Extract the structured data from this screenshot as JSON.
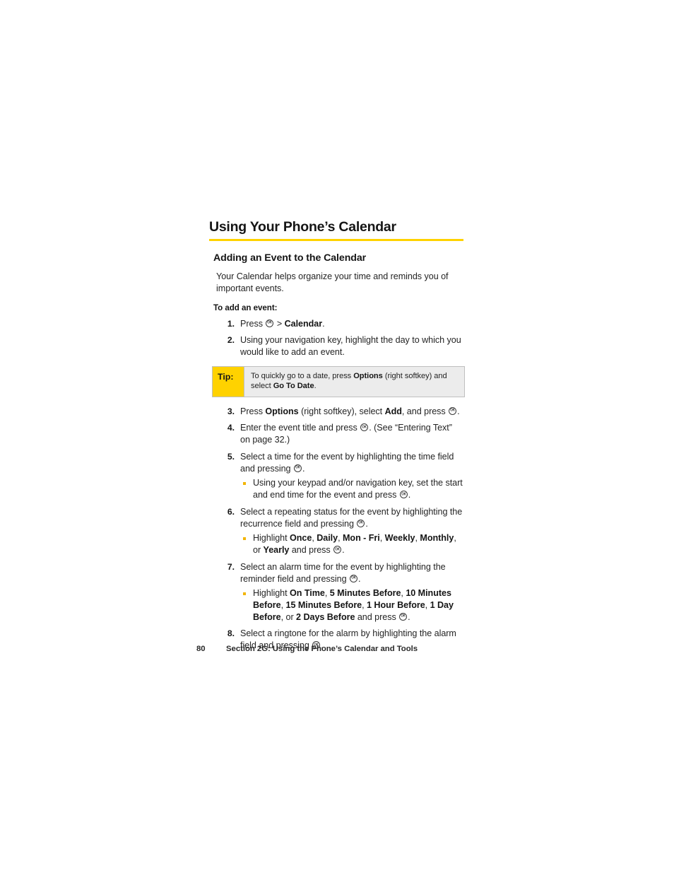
{
  "page": {
    "heading": "Using Your Phone’s Calendar",
    "accent_color": "#FFD200",
    "rule_color": "#FFD200",
    "bullet_color": "#F2B400"
  },
  "section": {
    "subheading": "Adding an Event to the Calendar",
    "intro": "Your Calendar helps organize your time and reminds you of important events.",
    "lead_in": "To add an event:"
  },
  "steps": [
    {
      "number": "1.",
      "parts": [
        {
          "t": "text",
          "v": "Press "
        },
        {
          "t": "okkey"
        },
        {
          "t": "text",
          "v": " > "
        },
        {
          "t": "bold",
          "v": "Calendar"
        },
        {
          "t": "text",
          "v": "."
        }
      ]
    },
    {
      "number": "2.",
      "parts": [
        {
          "t": "text",
          "v": "Using your navigation key, highlight the day to which you would like to add an event."
        }
      ]
    },
    {
      "number": "3.",
      "parts": [
        {
          "t": "text",
          "v": "Press "
        },
        {
          "t": "bold",
          "v": "Options"
        },
        {
          "t": "text",
          "v": " (right softkey), select "
        },
        {
          "t": "bold",
          "v": "Add"
        },
        {
          "t": "text",
          "v": ", and press "
        },
        {
          "t": "okkey"
        },
        {
          "t": "text",
          "v": "."
        }
      ]
    },
    {
      "number": "4.",
      "parts": [
        {
          "t": "text",
          "v": "Enter the event title and press "
        },
        {
          "t": "okkey"
        },
        {
          "t": "text",
          "v": ". (See “Entering Text” on page 32.)"
        }
      ]
    },
    {
      "number": "5.",
      "parts": [
        {
          "t": "text",
          "v": "Select a time for the event by highlighting the time field and pressing "
        },
        {
          "t": "okkey"
        },
        {
          "t": "text",
          "v": "."
        }
      ],
      "subs": [
        {
          "parts": [
            {
              "t": "text",
              "v": "Using your keypad and/or navigation key, set the start and end time for the event and press "
            },
            {
              "t": "okkey"
            },
            {
              "t": "text",
              "v": "."
            }
          ]
        }
      ]
    },
    {
      "number": "6.",
      "parts": [
        {
          "t": "text",
          "v": "Select a repeating status for the event by highlighting the recurrence field and pressing "
        },
        {
          "t": "okkey"
        },
        {
          "t": "text",
          "v": "."
        }
      ],
      "subs": [
        {
          "parts": [
            {
              "t": "text",
              "v": "Highlight "
            },
            {
              "t": "bold",
              "v": "Once"
            },
            {
              "t": "text",
              "v": ", "
            },
            {
              "t": "bold",
              "v": "Daily"
            },
            {
              "t": "text",
              "v": ", "
            },
            {
              "t": "bold",
              "v": "Mon - Fri"
            },
            {
              "t": "text",
              "v": ", "
            },
            {
              "t": "bold",
              "v": "Weekly"
            },
            {
              "t": "text",
              "v": ", "
            },
            {
              "t": "bold",
              "v": "Monthly"
            },
            {
              "t": "text",
              "v": ", or "
            },
            {
              "t": "bold",
              "v": "Yearly"
            },
            {
              "t": "text",
              "v": " and press "
            },
            {
              "t": "okkey"
            },
            {
              "t": "text",
              "v": "."
            }
          ]
        }
      ]
    },
    {
      "number": "7.",
      "parts": [
        {
          "t": "text",
          "v": "Select an alarm time for the event by highlighting the reminder field and pressing "
        },
        {
          "t": "okkey"
        },
        {
          "t": "text",
          "v": "."
        }
      ],
      "subs": [
        {
          "parts": [
            {
              "t": "text",
              "v": "Highlight "
            },
            {
              "t": "bold",
              "v": "On Time"
            },
            {
              "t": "text",
              "v": ", "
            },
            {
              "t": "bold",
              "v": "5 Minutes Before"
            },
            {
              "t": "text",
              "v": ", "
            },
            {
              "t": "bold",
              "v": "10 Minutes Before"
            },
            {
              "t": "text",
              "v": ", "
            },
            {
              "t": "bold",
              "v": "15 Minutes Before"
            },
            {
              "t": "text",
              "v": ", "
            },
            {
              "t": "bold",
              "v": "1 Hour Before"
            },
            {
              "t": "text",
              "v": ", "
            },
            {
              "t": "bold",
              "v": "1 Day Before"
            },
            {
              "t": "text",
              "v": ", or "
            },
            {
              "t": "bold",
              "v": "2 Days Before"
            },
            {
              "t": "text",
              "v": " and press "
            },
            {
              "t": "okkey"
            },
            {
              "t": "text",
              "v": "."
            }
          ]
        }
      ]
    },
    {
      "number": "8.",
      "parts": [
        {
          "t": "text",
          "v": "Select a ringtone for the alarm by highlighting the alarm field and pressing "
        },
        {
          "t": "okkey"
        },
        {
          "t": "text",
          "v": "."
        }
      ]
    }
  ],
  "tip": {
    "label": "Tip:",
    "after_step": 2,
    "parts": [
      {
        "t": "text",
        "v": "To quickly go to a date, press "
      },
      {
        "t": "bold",
        "v": "Options"
      },
      {
        "t": "text",
        "v": " (right softkey) and select "
      },
      {
        "t": "bold",
        "v": "Go To Date"
      },
      {
        "t": "text",
        "v": "."
      }
    ]
  },
  "footer": {
    "page_number": "80",
    "section_title": "Section 2G: Using the Phone’s Calendar and Tools"
  }
}
